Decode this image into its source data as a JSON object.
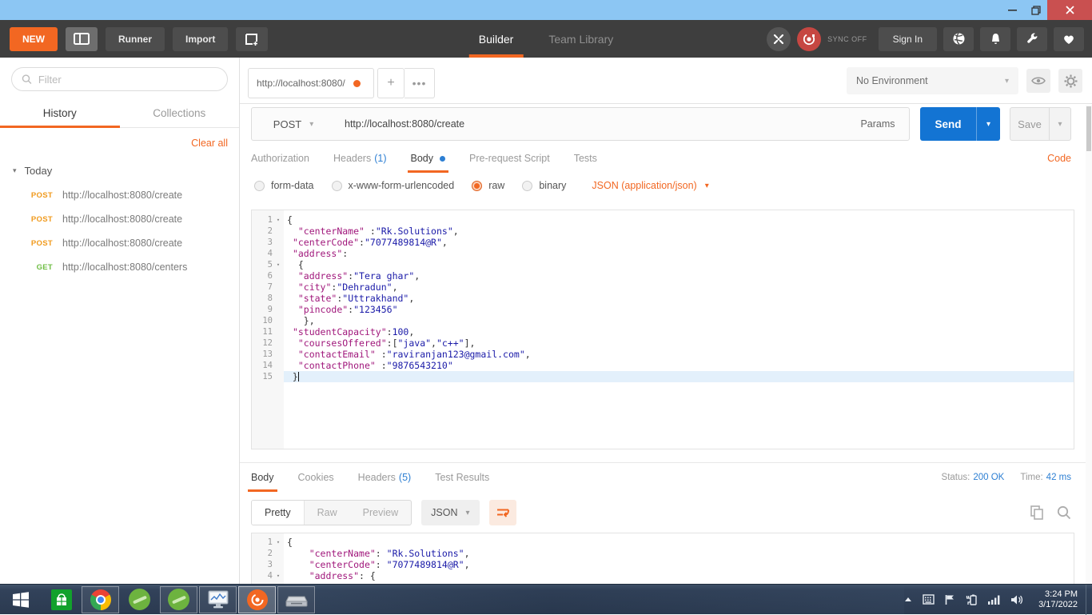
{
  "toolbar": {
    "new_label": "NEW",
    "runner_label": "Runner",
    "import_label": "Import",
    "builder_tab": "Builder",
    "team_library_tab": "Team Library",
    "sync_label": "SYNC OFF",
    "signin_label": "Sign In"
  },
  "sidebar": {
    "filter_placeholder": "Filter",
    "history_tab": "History",
    "collections_tab": "Collections",
    "clear_all_label": "Clear all",
    "group_label": "Today",
    "items": [
      {
        "method": "POST",
        "url": "http://localhost:8080/create"
      },
      {
        "method": "POST",
        "url": "http://localhost:8080/create"
      },
      {
        "method": "POST",
        "url": "http://localhost:8080/create"
      },
      {
        "method": "GET",
        "url": "http://localhost:8080/centers"
      }
    ]
  },
  "tabstrip": {
    "request_tab_label": "http://localhost:8080/",
    "environment_label": "No Environment"
  },
  "request": {
    "method": "POST",
    "url": "http://localhost:8080/create",
    "params_label": "Params",
    "send_label": "Send",
    "save_label": "Save",
    "tab_authorization": "Authorization",
    "tab_headers": "Headers",
    "headers_count": "(1)",
    "tab_body": "Body",
    "tab_prerequest": "Pre-request Script",
    "tab_tests": "Tests",
    "code_link": "Code",
    "mode_form_data": "form-data",
    "mode_urlencoded": "x-www-form-urlencoded",
    "mode_raw": "raw",
    "mode_binary": "binary",
    "content_type": "JSON (application/json)",
    "body_lines": [
      {
        "n": "1",
        "fold": true,
        "tokens": [
          [
            "p",
            "{"
          ]
        ]
      },
      {
        "n": "2",
        "tokens": [
          [
            "p",
            "  "
          ],
          [
            "k",
            "\"centerName\""
          ],
          [
            "p",
            " :"
          ],
          [
            "v",
            "\"Rk.Solutions\""
          ],
          [
            "p",
            ","
          ]
        ]
      },
      {
        "n": "3",
        "tokens": [
          [
            "p",
            " "
          ],
          [
            "k",
            "\"centerCode\""
          ],
          [
            "p",
            ":"
          ],
          [
            "v",
            "\"7077489814@R\""
          ],
          [
            "p",
            ","
          ]
        ]
      },
      {
        "n": "4",
        "tokens": [
          [
            "p",
            " "
          ],
          [
            "k",
            "\"address\""
          ],
          [
            "p",
            ":"
          ]
        ]
      },
      {
        "n": "5",
        "fold": true,
        "tokens": [
          [
            "p",
            "  {"
          ]
        ]
      },
      {
        "n": "6",
        "tokens": [
          [
            "p",
            "  "
          ],
          [
            "k",
            "\"address\""
          ],
          [
            "p",
            ":"
          ],
          [
            "v",
            "\"Tera ghar\""
          ],
          [
            "p",
            ","
          ]
        ]
      },
      {
        "n": "7",
        "tokens": [
          [
            "p",
            "  "
          ],
          [
            "k",
            "\"city\""
          ],
          [
            "p",
            ":"
          ],
          [
            "v",
            "\"Dehradun\""
          ],
          [
            "p",
            ","
          ]
        ]
      },
      {
        "n": "8",
        "tokens": [
          [
            "p",
            "  "
          ],
          [
            "k",
            "\"state\""
          ],
          [
            "p",
            ":"
          ],
          [
            "v",
            "\"Uttrakhand\""
          ],
          [
            "p",
            ","
          ]
        ]
      },
      {
        "n": "9",
        "tokens": [
          [
            "p",
            "  "
          ],
          [
            "k",
            "\"pincode\""
          ],
          [
            "p",
            ":"
          ],
          [
            "v",
            "\"123456\""
          ]
        ]
      },
      {
        "n": "10",
        "tokens": [
          [
            "p",
            "   },"
          ]
        ]
      },
      {
        "n": "11",
        "tokens": [
          [
            "p",
            " "
          ],
          [
            "k",
            "\"studentCapacity\""
          ],
          [
            "p",
            ":"
          ],
          [
            "v",
            "100"
          ],
          [
            "p",
            ","
          ]
        ]
      },
      {
        "n": "12",
        "tokens": [
          [
            "p",
            "  "
          ],
          [
            "k",
            "\"coursesOffered\""
          ],
          [
            "p",
            ":["
          ],
          [
            "v",
            "\"java\""
          ],
          [
            "p",
            ","
          ],
          [
            "v",
            "\"c++\""
          ],
          [
            "p",
            "],"
          ]
        ]
      },
      {
        "n": "13",
        "tokens": [
          [
            "p",
            "  "
          ],
          [
            "k",
            "\"contactEmail\""
          ],
          [
            "p",
            " :"
          ],
          [
            "v",
            "\"raviranjan123@gmail.com\""
          ],
          [
            "p",
            ","
          ]
        ]
      },
      {
        "n": "14",
        "tokens": [
          [
            "p",
            "  "
          ],
          [
            "k",
            "\"contactPhone\""
          ],
          [
            "p",
            " :"
          ],
          [
            "v",
            "\"9876543210\""
          ]
        ]
      },
      {
        "n": "15",
        "active": true,
        "cursor": true,
        "tokens": [
          [
            "p",
            " }"
          ]
        ]
      }
    ]
  },
  "response": {
    "tab_body": "Body",
    "tab_cookies": "Cookies",
    "tab_headers": "Headers",
    "headers_count": "(5)",
    "tab_test_results": "Test Results",
    "status_label": "Status:",
    "status_value": "200 OK",
    "time_label": "Time:",
    "time_value": "42 ms",
    "view_pretty": "Pretty",
    "view_raw": "Raw",
    "view_preview": "Preview",
    "format_label": "JSON",
    "body_lines": [
      {
        "n": "1",
        "fold": true,
        "tokens": [
          [
            "p",
            "{"
          ]
        ]
      },
      {
        "n": "2",
        "tokens": [
          [
            "p",
            "    "
          ],
          [
            "k",
            "\"centerName\""
          ],
          [
            "p",
            ": "
          ],
          [
            "v",
            "\"Rk.Solutions\""
          ],
          [
            "p",
            ","
          ]
        ]
      },
      {
        "n": "3",
        "tokens": [
          [
            "p",
            "    "
          ],
          [
            "k",
            "\"centerCode\""
          ],
          [
            "p",
            ": "
          ],
          [
            "v",
            "\"7077489814@R\""
          ],
          [
            "p",
            ","
          ]
        ]
      },
      {
        "n": "4",
        "fold": true,
        "tokens": [
          [
            "p",
            "    "
          ],
          [
            "k",
            "\"address\""
          ],
          [
            "p",
            ": {"
          ]
        ]
      }
    ]
  },
  "colors": {
    "accent_orange": "#F26722",
    "send_blue": "#1374D3",
    "link_blue": "#2D7FD3",
    "post_color": "#F09A1D",
    "get_color": "#6FBE44",
    "code_key": "#A0177B",
    "code_value": "#1A1AA8",
    "titlebar_blue": "#8CC6F3",
    "close_red": "#C95050"
  },
  "taskbar": {
    "time": "3:24 PM",
    "date": "3/17/2022"
  }
}
